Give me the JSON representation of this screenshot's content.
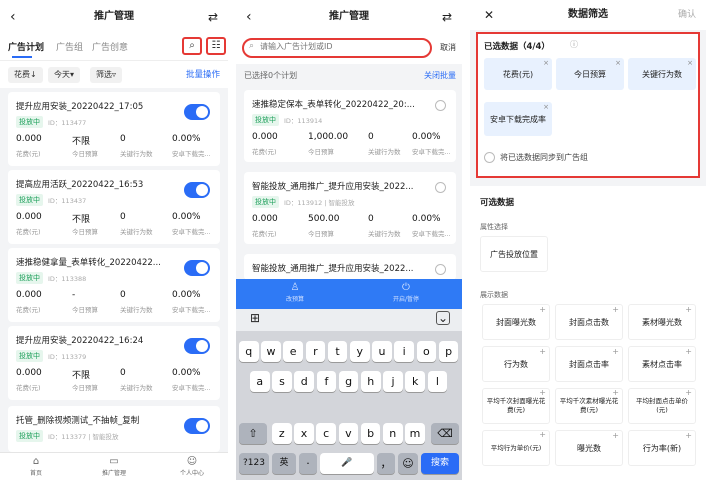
{
  "panel1": {
    "title": "推广管理",
    "back": "‹",
    "switch": "⇄",
    "tabs": [
      "广告计划",
      "广告组",
      "广告创意"
    ],
    "search_icon": "search-icon",
    "settings_icon": "sliders-icon",
    "filters": [
      "花费↓",
      "今天▾",
      "筛选▿"
    ],
    "batch": "批量操作",
    "metric_labels": [
      "花费(元)",
      "今日预算",
      "关键行为数",
      "安卓下载完..."
    ],
    "cards": [
      {
        "title": "提升应用安装_20220422_17:05",
        "status": "投放中",
        "id": "ID：113477",
        "values": [
          "0.000",
          "不限",
          "0",
          "0.00%"
        ]
      },
      {
        "title": "提高应用活跃_20220422_16:53",
        "status": "投放中",
        "id": "ID：113437",
        "values": [
          "0.000",
          "不限",
          "0",
          "0.00%"
        ]
      },
      {
        "title": "速推稳健拿量_表单转化_20220422...",
        "status": "投放中",
        "id": "ID：113388",
        "values": [
          "0.000",
          "-",
          "0",
          "0.00%"
        ]
      },
      {
        "title": "提升应用安装_20220422_16:24",
        "status": "投放中",
        "id": "ID：113379",
        "values": [
          "0.000",
          "不限",
          "0",
          "0.00%"
        ]
      },
      {
        "title": "托管_删除视频测试_不抽帧_复制",
        "status": "投放中",
        "id": "ID：113377 | 智能投放",
        "values": [
          "",
          "",
          "",
          ""
        ]
      }
    ],
    "bottom_nav": [
      {
        "icon": "home-icon",
        "glyph": "⌂",
        "label": "首页"
      },
      {
        "icon": "folder-icon",
        "glyph": "▭",
        "label": "推广管理"
      },
      {
        "icon": "user-icon",
        "glyph": "☺",
        "label": "个人中心"
      }
    ]
  },
  "panel2": {
    "title": "推广管理",
    "back": "‹",
    "switch": "⇄",
    "search_placeholder": "请输入广告计划或ID",
    "cancel": "取消",
    "selected": "已选择0个计划",
    "close_batch": "关闭批量",
    "metric_labels": [
      "花费(元)",
      "今日预算",
      "关键行为数",
      "安卓下载完..."
    ],
    "cards": [
      {
        "title": "速推稳定保本_表单转化_20220422_20:...",
        "status": "投放中",
        "id": "ID：113914",
        "values": [
          "0.000",
          "1,000.00",
          "0",
          "0.00%"
        ]
      },
      {
        "title": "智能投放_通用推广_提升应用安装_2022...",
        "status": "投放中",
        "id": "ID：113912 | 智能投放",
        "values": [
          "0.000",
          "500.00",
          "0",
          "0.00%"
        ]
      },
      {
        "title": "智能投放_通用推广_提升应用安装_2022...",
        "status": "投放中",
        "id": "",
        "values": [
          "",
          "",
          "",
          ""
        ]
      }
    ],
    "blue_bar": [
      "改预算",
      "开启/暂停"
    ],
    "keyboard": {
      "row1": [
        "q",
        "w",
        "e",
        "r",
        "t",
        "y",
        "u",
        "i",
        "o",
        "p"
      ],
      "row2": [
        "a",
        "s",
        "d",
        "f",
        "g",
        "h",
        "j",
        "k",
        "l"
      ],
      "row3": [
        "z",
        "x",
        "c",
        "v",
        "b",
        "n",
        "m"
      ],
      "shift": "⇧",
      "delete": "⌫",
      "num": "?123",
      "lang": "英",
      "dot": "·",
      "space": "🎤",
      "comma": "，",
      "emoji": "☺",
      "search": "搜索",
      "grid": "⊞",
      "collapse": "⌄"
    }
  },
  "panel3": {
    "close": "✕",
    "title": "数据筛选",
    "confirm": "确认",
    "selected_header": "已选数据（4/4）",
    "selected": [
      "花费(元)",
      "今日预算",
      "关键行为数",
      "安卓下载完成率"
    ],
    "sync_label": "将已选数据同步到广告组",
    "available_header": "可选数据",
    "attr_header": "属性选择",
    "attrs": [
      "广告投放位置"
    ],
    "display_header": "展示数据",
    "display": [
      "封面曝光数",
      "封面点击数",
      "素材曝光数",
      "行为数",
      "封面点击率",
      "素材点击率",
      "平均千次封面曝光花费(元)",
      "平均千次素材曝光花费(元)",
      "平均封面点击单价(元)",
      "平均行为单价(元)",
      "曝光数",
      "行为率(新)"
    ]
  }
}
